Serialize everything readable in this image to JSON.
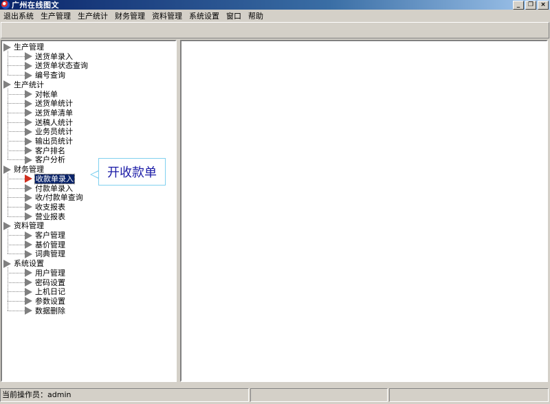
{
  "window": {
    "title": "广州在线图文",
    "min_label": "_",
    "restore_label": "❐",
    "close_label": "×"
  },
  "menubar": {
    "items": [
      "退出系统",
      "生产管理",
      "生产统计",
      "财务管理",
      "资料管理",
      "系统设置",
      "窗口",
      "帮助"
    ]
  },
  "tree": {
    "groups": [
      {
        "label": "生产管理",
        "children": [
          "送货单录入",
          "送货单状态查询",
          "编号查询"
        ]
      },
      {
        "label": "生产统计",
        "children": [
          "对帐单",
          "送货单统计",
          "送货单清单",
          "送稿人统计",
          "业务员统计",
          "输出员统计",
          "客户排名",
          "客户分析"
        ]
      },
      {
        "label": "财务管理",
        "children": [
          "收款单录入",
          "付款单录入",
          "收/付款单查询",
          "收支报表",
          "营业报表"
        ]
      },
      {
        "label": "资料管理",
        "children": [
          "客户管理",
          "基价管理",
          "词典管理"
        ]
      },
      {
        "label": "系统设置",
        "children": [
          "用户管理",
          "密码设置",
          "上机日记",
          "参数设置",
          "数据删除"
        ]
      }
    ],
    "selected": "收款单录入"
  },
  "callout": {
    "text": "开收款单"
  },
  "status": {
    "operator": "当前操作员：admin",
    "pane2": "",
    "pane3": ""
  },
  "colors": {
    "titlebar": "#0a246a",
    "selection": "#0a246a",
    "callout_border": "#7fd0ef",
    "callout_text": "#1a1aa6"
  }
}
